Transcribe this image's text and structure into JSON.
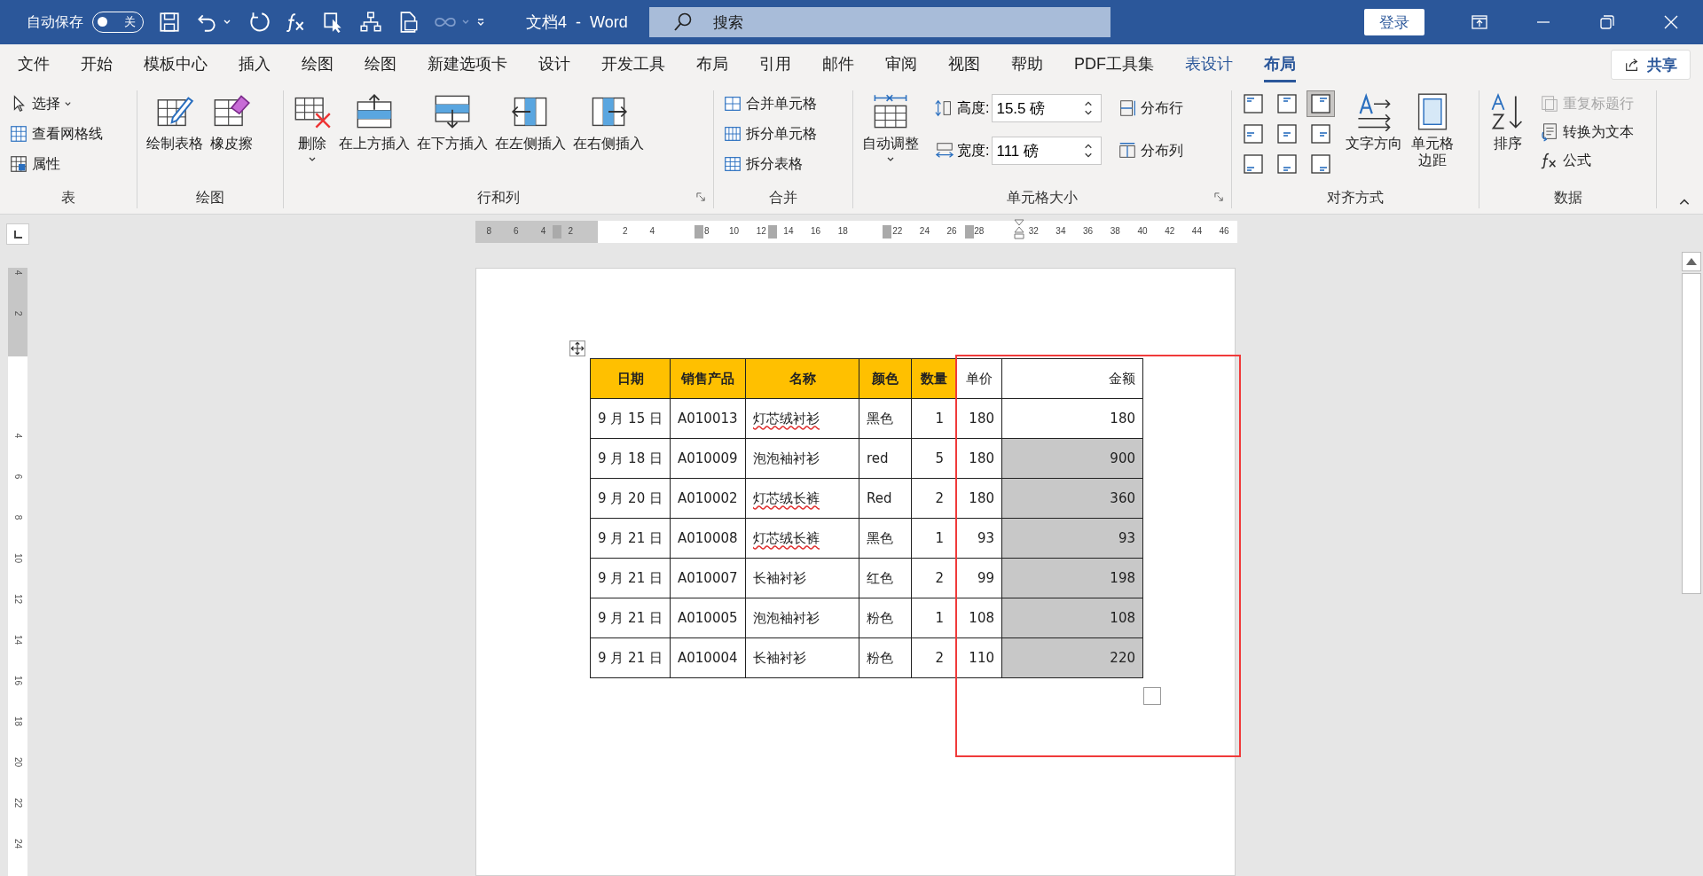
{
  "title_bar": {
    "autosave_label": "自动保存",
    "autosave": {
      "on": false,
      "label": "关"
    },
    "title": "文档4  -  Word",
    "search": {
      "placeholder": "搜索"
    },
    "login": "登录"
  },
  "tabs": [
    {
      "label": "文件",
      "selected": false,
      "contextual": false
    },
    {
      "label": "开始",
      "selected": false,
      "contextual": false
    },
    {
      "label": "模板中心",
      "selected": false,
      "contextual": false
    },
    {
      "label": "插入",
      "selected": false,
      "contextual": false
    },
    {
      "label": "绘图",
      "selected": false,
      "contextual": false
    },
    {
      "label": "绘图",
      "selected": false,
      "contextual": false
    },
    {
      "label": "新建选项卡",
      "selected": false,
      "contextual": false
    },
    {
      "label": "设计",
      "selected": false,
      "contextual": false
    },
    {
      "label": "开发工具",
      "selected": false,
      "contextual": false
    },
    {
      "label": "布局",
      "selected": false,
      "contextual": false
    },
    {
      "label": "引用",
      "selected": false,
      "contextual": false
    },
    {
      "label": "邮件",
      "selected": false,
      "contextual": false
    },
    {
      "label": "审阅",
      "selected": false,
      "contextual": false
    },
    {
      "label": "视图",
      "selected": false,
      "contextual": false
    },
    {
      "label": "帮助",
      "selected": false,
      "contextual": false
    },
    {
      "label": "PDF工具集",
      "selected": false,
      "contextual": false
    },
    {
      "label": "表设计",
      "selected": false,
      "contextual": true
    },
    {
      "label": "布局",
      "selected": true,
      "contextual": true
    }
  ],
  "share": "共享",
  "ribbon": [
    {
      "label": "表",
      "items": [
        {
          "kind": "small",
          "label": "选择",
          "dropdown": true
        },
        {
          "kind": "small",
          "label": "查看网格线"
        },
        {
          "kind": "small",
          "label": "属性"
        }
      ]
    },
    {
      "label": "绘图",
      "items": [
        {
          "kind": "large",
          "label": "绘制表格"
        },
        {
          "kind": "large",
          "label": "橡皮擦"
        }
      ]
    },
    {
      "label": "行和列",
      "launcher": true,
      "items": [
        {
          "kind": "large",
          "label": "删除",
          "dropdown": true
        },
        {
          "kind": "large",
          "label": "在上方插入"
        },
        {
          "kind": "large",
          "label": "在下方插入"
        },
        {
          "kind": "large",
          "label": "在左侧插入"
        },
        {
          "kind": "large",
          "label": "在右侧插入"
        }
      ]
    },
    {
      "label": "合并",
      "items": [
        {
          "kind": "small",
          "label": "合并单元格"
        },
        {
          "kind": "small",
          "label": "拆分单元格"
        },
        {
          "kind": "small",
          "label": "拆分表格"
        }
      ]
    },
    {
      "label": "单元格大小",
      "launcher": true,
      "items": [
        {
          "kind": "large",
          "label": "自动调整",
          "dropdown": true
        },
        {
          "kind": "spin",
          "label": "高度:",
          "value": "15.5 磅"
        },
        {
          "kind": "spin",
          "label": "宽度:",
          "value": "111 磅"
        },
        {
          "kind": "small",
          "label": "分布行"
        },
        {
          "kind": "small",
          "label": "分布列"
        }
      ]
    },
    {
      "label": "对齐方式",
      "items": [
        {
          "kind": "align",
          "cells": [
            {
              "selected": false
            },
            {
              "selected": false
            },
            {
              "selected": true
            },
            {
              "selected": false
            },
            {
              "selected": false
            },
            {
              "selected": false
            },
            {
              "selected": false
            },
            {
              "selected": false
            },
            {
              "selected": false
            }
          ]
        },
        {
          "kind": "large",
          "label": "文字方向"
        },
        {
          "kind": "large",
          "label": "单元格边距"
        }
      ]
    },
    {
      "label": "数据",
      "items": [
        {
          "kind": "large",
          "label": "排序"
        },
        {
          "kind": "small",
          "label": "重复标题行",
          "disabled": true
        },
        {
          "kind": "small",
          "label": "转换为文本",
          "disabled": false
        },
        {
          "kind": "small",
          "label": "公式",
          "disabled": false
        }
      ]
    }
  ],
  "ruler": {
    "left_labels": [
      "8",
      "6",
      "4",
      "2"
    ],
    "right_labels": [
      "2",
      "4",
      "8",
      "10",
      "12",
      "14",
      "16",
      "18",
      "22",
      "24",
      "26",
      "28",
      "32",
      "34",
      "36",
      "38",
      "40",
      "42",
      "44",
      "46"
    ]
  },
  "vertical_ruler": {
    "top_labels": [
      "4",
      "2"
    ],
    "bottom_labels": [
      "4",
      "6",
      "8",
      "10",
      "12",
      "14",
      "16",
      "18",
      "20",
      "22",
      "24"
    ]
  },
  "table": {
    "columns": [
      {
        "label": "日期",
        "shaded": true
      },
      {
        "label": "销售产品",
        "shaded": true
      },
      {
        "label": "名称",
        "shaded": true
      },
      {
        "label": "颜色",
        "shaded": true
      },
      {
        "label": "数量",
        "shaded": true
      },
      {
        "label": "单价",
        "shaded": false
      },
      {
        "label": "金额",
        "shaded": false
      }
    ],
    "rows": [
      {
        "cells": [
          "9 月 15 日",
          "A010013",
          "灯芯绒衬衫",
          "黑色",
          "1",
          "180",
          "180"
        ],
        "name_flagged": true,
        "amount_shaded": false
      },
      {
        "cells": [
          "9 月 18 日",
          "A010009",
          "泡泡袖衬衫",
          "red",
          "5",
          "180",
          "900"
        ],
        "name_flagged": false,
        "amount_shaded": true
      },
      {
        "cells": [
          "9 月 20 日",
          "A010002",
          "灯芯绒长裤",
          "Red",
          "2",
          "180",
          "360"
        ],
        "name_flagged": true,
        "amount_shaded": true
      },
      {
        "cells": [
          "9 月 21 日",
          "A010008",
          "灯芯绒长裤",
          "黑色",
          "1",
          "93",
          "93"
        ],
        "name_flagged": true,
        "amount_shaded": true
      },
      {
        "cells": [
          "9 月 21 日",
          "A010007",
          "长袖衬衫",
          "红色",
          "2",
          "99",
          "198"
        ],
        "name_flagged": false,
        "amount_shaded": true
      },
      {
        "cells": [
          "9 月 21 日",
          "A010005",
          "泡泡袖衬衫",
          "粉色",
          "1",
          "108",
          "108"
        ],
        "name_flagged": false,
        "amount_shaded": true
      },
      {
        "cells": [
          "9 月 21 日",
          "A010004",
          "长袖衬衫",
          "粉色",
          "2",
          "110",
          "220"
        ],
        "name_flagged": false,
        "amount_shaded": true
      }
    ]
  }
}
